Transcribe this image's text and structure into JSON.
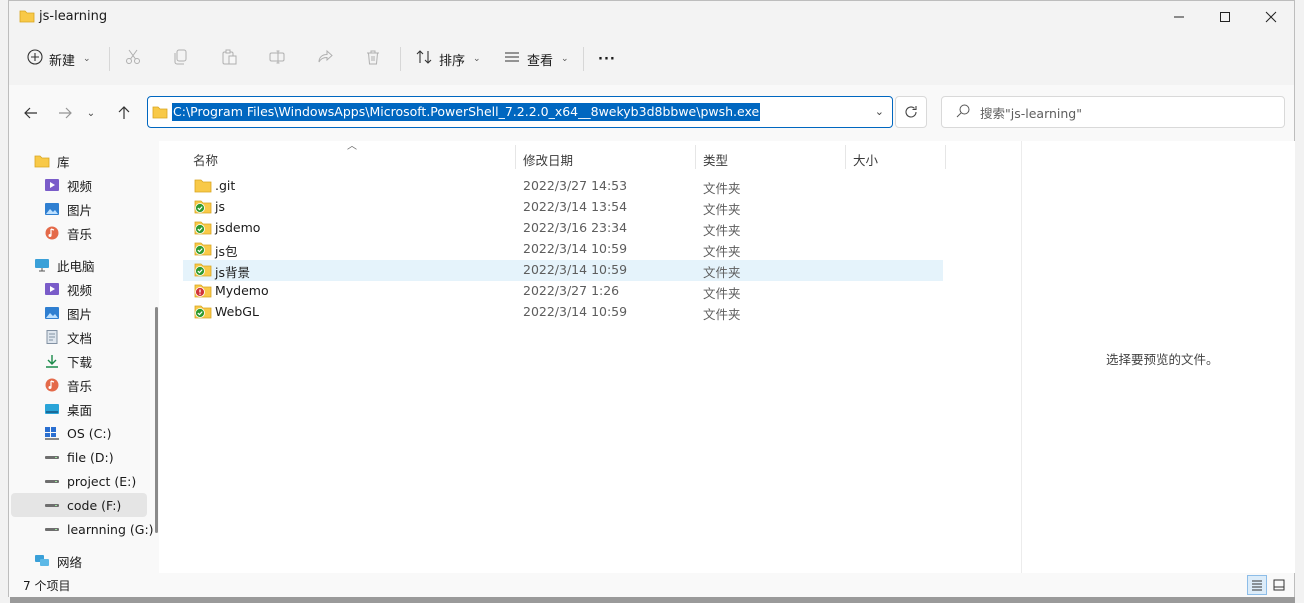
{
  "window": {
    "title": "js-learning",
    "controls": [
      "minimize",
      "maximize",
      "close"
    ]
  },
  "commandbar": {
    "new_label": "新建",
    "sort_label": "排序",
    "view_label": "查看",
    "more_label": "···"
  },
  "address": {
    "path": "C:\\Program Files\\WindowsApps\\Microsoft.PowerShell_7.2.2.0_x64__8wekyb3d8bbwe\\pwsh.exe",
    "search_placeholder": "搜索\"js-learning\""
  },
  "sidebar": {
    "items": [
      {
        "label": "库",
        "icon": "library-folder-icon"
      },
      {
        "label": "视频",
        "icon": "videos-icon"
      },
      {
        "label": "图片",
        "icon": "pictures-icon"
      },
      {
        "label": "音乐",
        "icon": "music-icon"
      },
      {
        "label": "此电脑",
        "icon": "this-pc-icon"
      },
      {
        "label": "视频",
        "icon": "videos-icon"
      },
      {
        "label": "图片",
        "icon": "pictures-icon"
      },
      {
        "label": "文档",
        "icon": "documents-icon"
      },
      {
        "label": "下载",
        "icon": "downloads-icon"
      },
      {
        "label": "音乐",
        "icon": "music-icon"
      },
      {
        "label": "桌面",
        "icon": "desktop-icon"
      },
      {
        "label": "OS (C:)",
        "icon": "windows-drive-icon"
      },
      {
        "label": "file (D:)",
        "icon": "drive-icon"
      },
      {
        "label": "project (E:)",
        "icon": "drive-icon"
      },
      {
        "label": "code (F:)",
        "icon": "drive-icon"
      },
      {
        "label": "learnning (G:)",
        "icon": "drive-icon"
      },
      {
        "label": "网络",
        "icon": "network-icon"
      }
    ]
  },
  "columns": {
    "name": "名称",
    "modified": "修改日期",
    "type": "类型",
    "size": "大小"
  },
  "files": [
    {
      "name": ".git",
      "modified": "2022/3/27 14:53",
      "type": "文件夹",
      "status": "none"
    },
    {
      "name": "js",
      "modified": "2022/3/14 13:54",
      "type": "文件夹",
      "status": "synced"
    },
    {
      "name": "jsdemo",
      "modified": "2022/3/16 23:34",
      "type": "文件夹",
      "status": "synced"
    },
    {
      "name": "js包",
      "modified": "2022/3/14 10:59",
      "type": "文件夹",
      "status": "synced"
    },
    {
      "name": "js背景",
      "modified": "2022/3/14 10:59",
      "type": "文件夹",
      "status": "synced"
    },
    {
      "name": "Mydemo",
      "modified": "2022/3/27 1:26",
      "type": "文件夹",
      "status": "error"
    },
    {
      "name": "WebGL",
      "modified": "2022/3/14 10:59",
      "type": "文件夹",
      "status": "synced"
    }
  ],
  "preview": {
    "empty_text": "选择要预览的文件。"
  },
  "status": {
    "count_text": "7 个项目"
  },
  "colors": {
    "accent": "#0067c0",
    "folder": "#f8c948",
    "synced": "#2e9a2e",
    "error": "#d13438",
    "selection": "#e5f3fb"
  }
}
